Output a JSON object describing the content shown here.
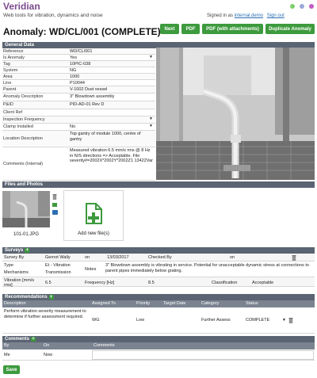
{
  "header": {
    "brand": "Veridian",
    "tagline": "Web tools for vibration, dynamics and noise",
    "signed_in_prefix": "Signed in as",
    "user_email": "internal.demo",
    "sign_out": "Sign out",
    "dots": [
      "#7fcf6a",
      "#9aa9d6",
      "#c35ac1"
    ]
  },
  "title": "Anomaly: WD/CL/001 (COMPLETE)",
  "buttons": {
    "next": "Next",
    "pdf": "PDF",
    "pdf_attach": "PDF (with attachments)",
    "duplicate": "Duplicate Anomaly"
  },
  "general": {
    "heading": "General Data",
    "rows": [
      {
        "label": "Reference",
        "value": "WD/CL/001"
      },
      {
        "label": "Is Anomaly",
        "value": "Yes"
      },
      {
        "label": "Tag",
        "value": "10PIC-038"
      },
      {
        "label": "System",
        "value": "NG"
      },
      {
        "label": "Area",
        "value": "1000"
      },
      {
        "label": "Line",
        "value": "P10044"
      },
      {
        "label": "Parent",
        "value": "V-1002 Dust vessel"
      },
      {
        "label": "Anomaly Description",
        "value": "3\" Blowdown assembly"
      },
      {
        "label": "P&ID",
        "value": "PID-AD-01 Rev D"
      },
      {
        "label": "Client Ref",
        "value": ""
      },
      {
        "label": "Inspection Frequency",
        "value": ""
      },
      {
        "label": "Clamp Installed",
        "value": "No"
      },
      {
        "label": "Location Description",
        "value": "Top gantry of module 1000, centre of gantry"
      },
      {
        "label": "Comments (Internal)",
        "value": "Measured vibration 6.5 mm/s rms @ 8 Hz in N/S directions => Acceptable. File severity#=2002X*2002Y*2002Z1 13422Var"
      }
    ]
  },
  "files": {
    "heading": "Files and Photos",
    "file_name": "101-01.JPG",
    "add_label": "Add new file(s)"
  },
  "surveys": {
    "heading": "Surveys",
    "survey_by_label": "Survey By",
    "survey_by": "Gernot Wally",
    "on_label": "on",
    "date": "13/03/2017",
    "checked_by_label": "Checked By",
    "checked_by": "",
    "on2_label": "on",
    "type_label": "Type",
    "type_value": "Et - Vibration",
    "mechanism_label": "Mechanisms",
    "mechanism_value": "Transmission",
    "notes_label": "Notes",
    "notes": "3\" Blowdown assembly is vibrating in service. Potential for unacceptable dynamic stress at connections to parent pipes immediately below grating.",
    "vibration_label": "Vibration [mm/s rms]",
    "vibration": "6.5",
    "frequency_label": "Frequency [Hz]",
    "frequency": "8.5",
    "classification_label": "Classification",
    "classification": "Acceptable"
  },
  "recommendations": {
    "heading": "Recommendations",
    "columns": [
      "Description",
      "Assigned To",
      "Priority",
      "Target Date",
      "Category",
      "Status"
    ],
    "rows": [
      {
        "description": "Perform vibration severity measurement to determine if further assessment required.",
        "assigned": "WG",
        "priority": "Low",
        "target": "",
        "category": "Further Assess",
        "status": "COMPLETE"
      }
    ]
  },
  "comments": {
    "heading": "Comments",
    "columns": [
      "By",
      "On",
      "Comments"
    ],
    "by": "Me",
    "on": "Now"
  },
  "save": "Save"
}
